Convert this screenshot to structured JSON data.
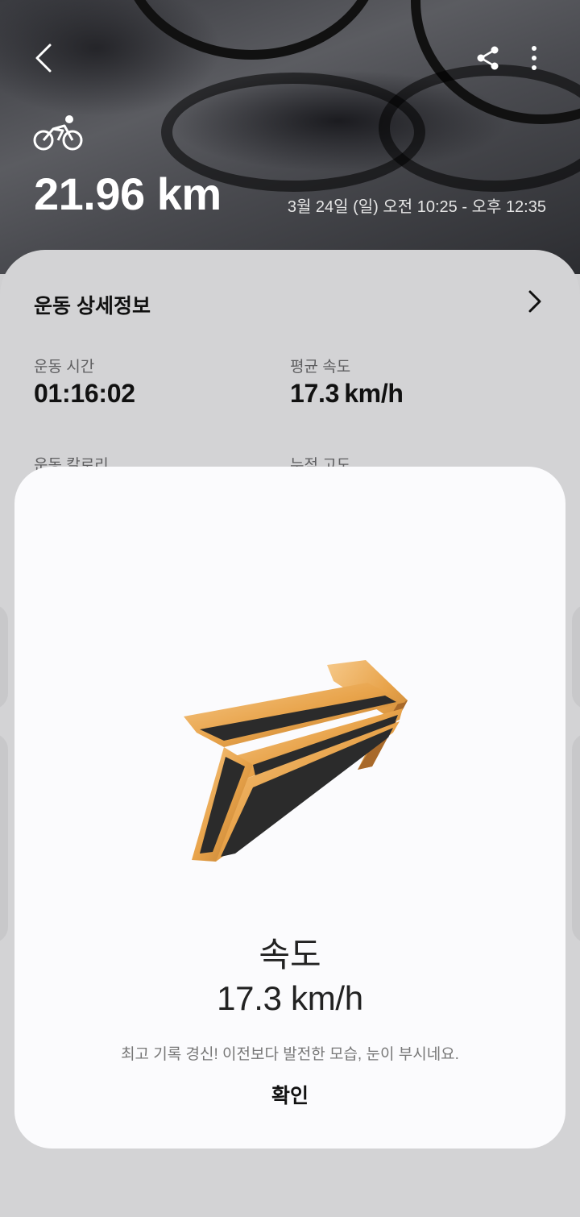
{
  "header": {
    "distance": "21.96 km",
    "datetime": "3월 24일 (일) 오전 10:25 - 오후 12:35",
    "activity_icon": "cycling-icon",
    "back_icon": "back-arrow-icon",
    "share_icon": "share-icon",
    "more_icon": "more-vert-icon"
  },
  "details": {
    "title": "운동 상세정보",
    "stats": [
      {
        "label": "운동 시간",
        "value": "01:16:02"
      },
      {
        "label": "평균 속도",
        "value": "17.3 km/h"
      },
      {
        "label": "운동 칼로리",
        "value": ""
      },
      {
        "label": "누적 고도",
        "value": ""
      }
    ]
  },
  "dialog": {
    "badge_icon": "gold-speed-arrow-icon",
    "title": "속도",
    "value": "17.3 km/h",
    "message": "최고 기록 경신! 이전보다 발전한 모습, 눈이 부시네요.",
    "confirm_label": "확인"
  },
  "colors": {
    "badge_gold": "#e8a34a",
    "badge_dark": "#2b2b2b",
    "dialog_bg": "#fbfbfd",
    "card_bg": "#d3d3d5"
  }
}
